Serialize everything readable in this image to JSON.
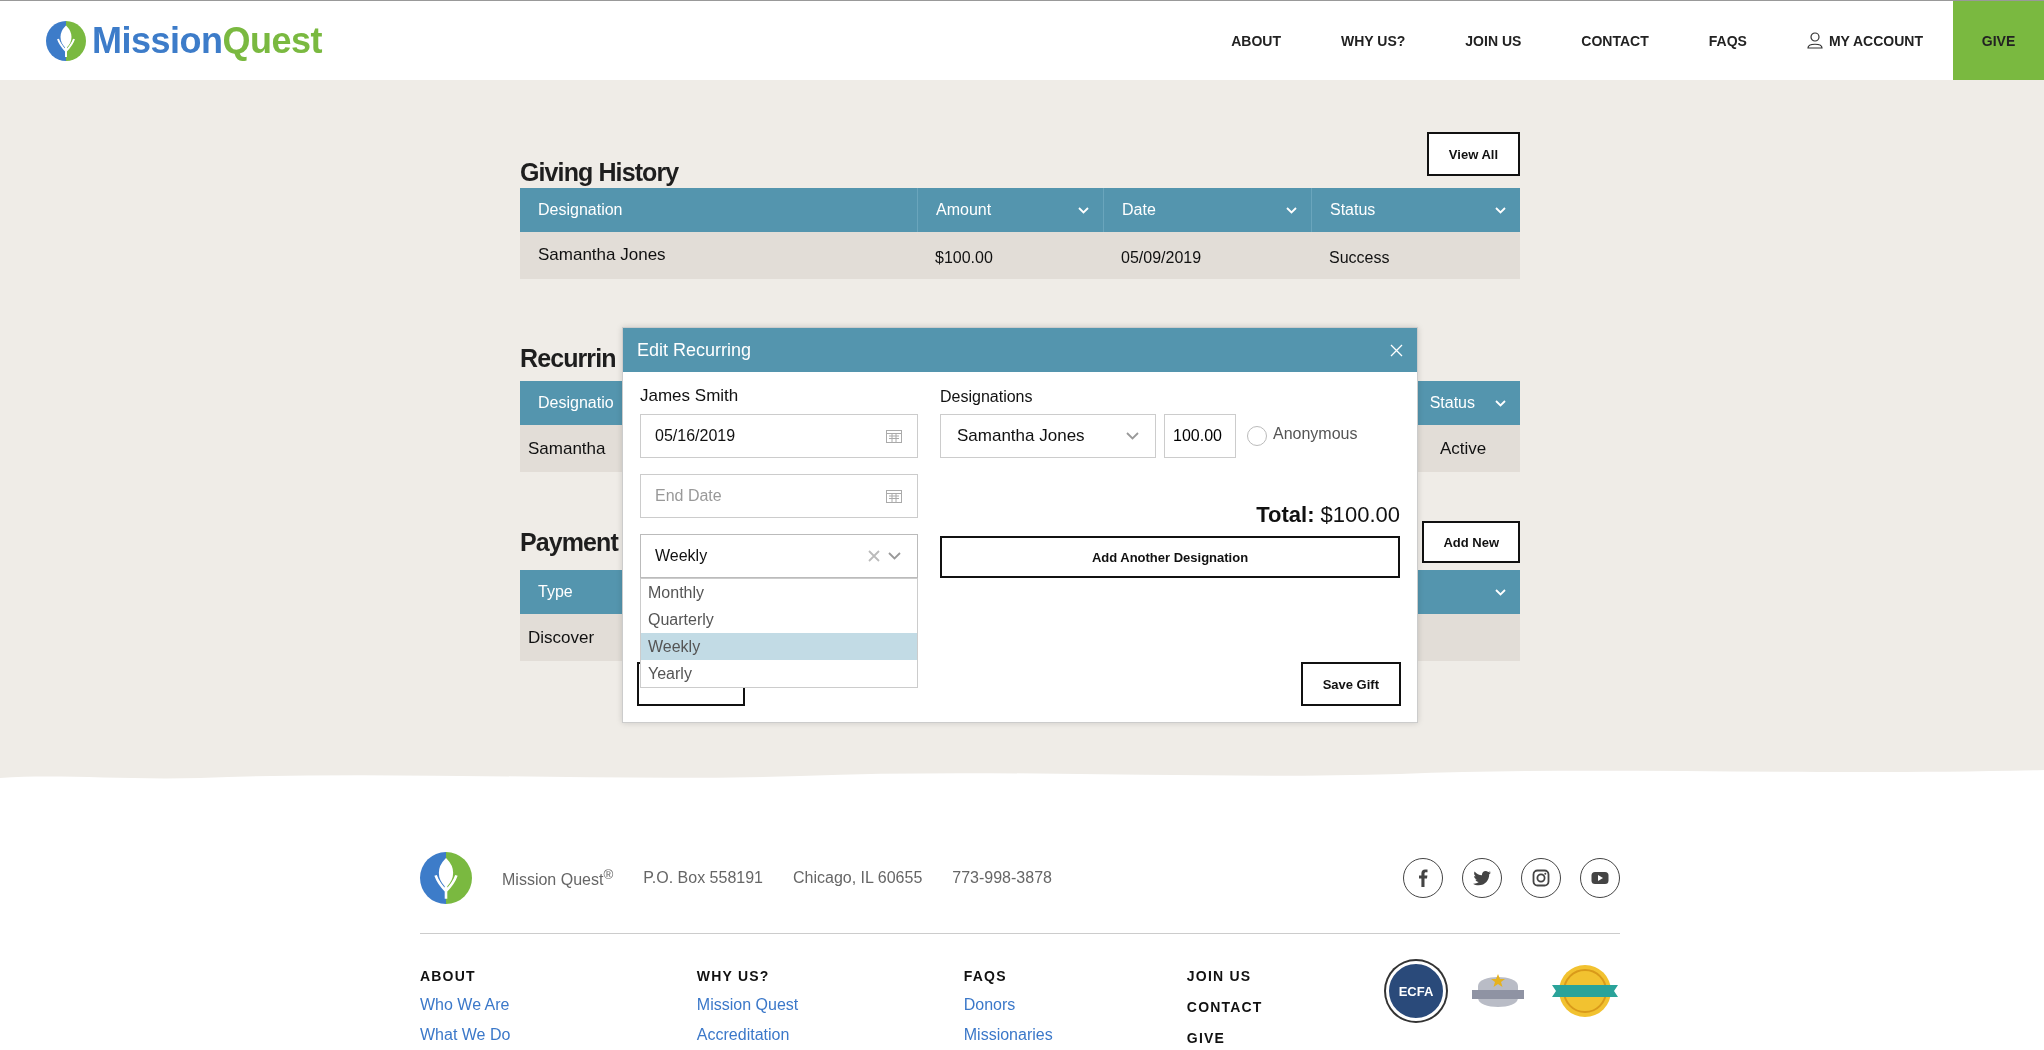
{
  "header": {
    "logo": {
      "first": "Mission",
      "second": "Quest"
    },
    "nav": [
      {
        "label": "ABOUT",
        "kind": "link"
      },
      {
        "label": "WHY US?",
        "kind": "link"
      },
      {
        "label": "JOIN US",
        "kind": "link"
      },
      {
        "label": "CONTACT",
        "kind": "link"
      },
      {
        "label": "FAQS",
        "kind": "link"
      },
      {
        "label": "MY ACCOUNT",
        "kind": "account"
      },
      {
        "label": "GIVE",
        "kind": "cta"
      }
    ]
  },
  "giving_history": {
    "title": "Giving History",
    "button": "View All",
    "columns": [
      {
        "label": "Designation",
        "sortable": false
      },
      {
        "label": "Amount",
        "sortable": true
      },
      {
        "label": "Date",
        "sortable": true
      },
      {
        "label": "Status",
        "sortable": true
      }
    ],
    "rows": [
      [
        "Samantha Jones",
        "$100.00",
        "05/09/2019",
        "Success"
      ]
    ]
  },
  "recurring": {
    "title": "Recurrin",
    "column_left": "Designatio",
    "column_right": "Status",
    "row_left": "Samantha",
    "row_right": "Active"
  },
  "payments": {
    "title": "Payment",
    "button": "Add New",
    "column": "Type",
    "row": "Discover"
  },
  "modal": {
    "title": "Edit Recurring",
    "donor": "James Smith",
    "start_date": {
      "value": "05/16/2019"
    },
    "end_date": {
      "placeholder": "End Date"
    },
    "frequency": {
      "value": "Weekly",
      "expanded": true,
      "options": [
        {
          "label": "Monthly",
          "selected": false
        },
        {
          "label": "Quarterly",
          "selected": false
        },
        {
          "label": "Weekly",
          "selected": true
        },
        {
          "label": "Yearly",
          "selected": false
        }
      ]
    },
    "designations_label": "Designations",
    "designation": {
      "value": "Samantha Jones"
    },
    "amount": {
      "value": "100.00"
    },
    "anonymous": {
      "label": "Anonymous",
      "checked": false
    },
    "total_label": "Total:",
    "total": "$100.00",
    "add_button": "Add Another Designation",
    "save_button": "Save Gift"
  },
  "footer": {
    "org": "Mission Quest$^{®}$",
    "contacts": [
      "P.O. Box 558191",
      "Chicago, IL 60655",
      "773-998-3878"
    ],
    "social": [
      {
        "kind": "facebook"
      },
      {
        "kind": "twitter"
      },
      {
        "kind": "instagram"
      },
      {
        "kind": "youtube"
      }
    ],
    "columns": [
      {
        "heading": "ABOUT",
        "links": [
          "Who We Are",
          "What We Do"
        ]
      },
      {
        "heading": "WHY US?",
        "links": [
          "Mission Quest",
          "Accreditation"
        ]
      },
      {
        "heading": "FAQS",
        "links": [
          "Donors",
          "Missionaries"
        ]
      }
    ],
    "plain_headings": [
      "JOIN US",
      "CONTACT",
      "GIVE"
    ],
    "badges": [
      {
        "kind": "ecfa",
        "label": "ECFA"
      },
      {
        "kind": "guidestar"
      },
      {
        "kind": "rated"
      }
    ]
  }
}
